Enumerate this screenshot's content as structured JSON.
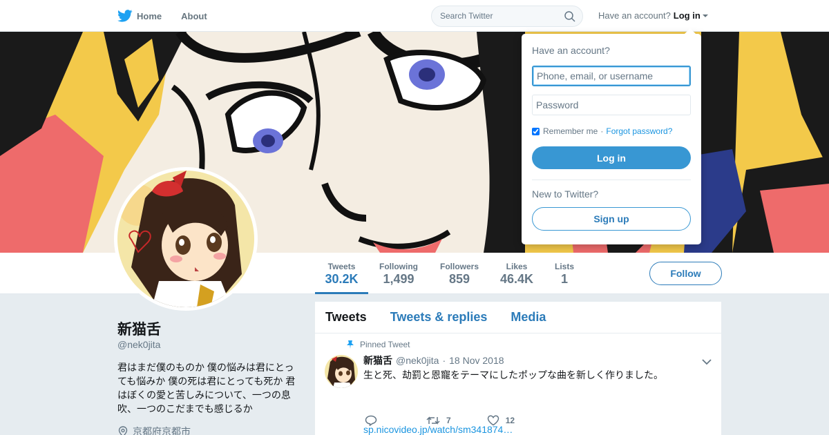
{
  "nav": {
    "home_label": "Home",
    "about_label": "About",
    "search_placeholder": "Search Twitter",
    "have_account": "Have an account?",
    "login_label": "Log in"
  },
  "stats": [
    {
      "label": "Tweets",
      "value": "30.2K"
    },
    {
      "label": "Following",
      "value": "1,499"
    },
    {
      "label": "Followers",
      "value": "859"
    },
    {
      "label": "Likes",
      "value": "46.4K"
    },
    {
      "label": "Lists",
      "value": "1"
    }
  ],
  "follow_label": "Follow",
  "profile": {
    "name": "新猫舌",
    "handle": "@nek0jita",
    "bio": "君はまだ僕のものか 僕の悩みは君にとっても悩みか 僕の死は君にとっても死か 君はぼくの愛と苦しみについて、一つの息吹、一つのこだまでも感じるか",
    "location": "京都府京都市"
  },
  "timeline": {
    "tabs": [
      "Tweets",
      "Tweets & replies",
      "Media"
    ],
    "pinned_label": "Pinned Tweet",
    "tweet": {
      "name": "新猫舌",
      "handle": "@nek0jita",
      "date": "18 Nov 2018",
      "text": "生と死、劫罰と恩寵をテーマにしたポップな曲を新しく作りました。",
      "link": "sp.nicovideo.jp/watch/sm341874…",
      "retweets": "7",
      "likes": "12"
    }
  },
  "login_dropdown": {
    "title": "Have an account?",
    "username_placeholder": "Phone, email, or username",
    "password_placeholder": "Password",
    "remember_label": "Remember me",
    "separator": "·",
    "forgot_label": "Forgot password?",
    "login_button": "Log in",
    "new_label": "New to Twitter?",
    "signup_button": "Sign up"
  },
  "colors": {
    "accent": "#2b7bb9",
    "link": "#1b95e0",
    "button": "#3897d3",
    "twitter_blue": "#1da1f2"
  }
}
